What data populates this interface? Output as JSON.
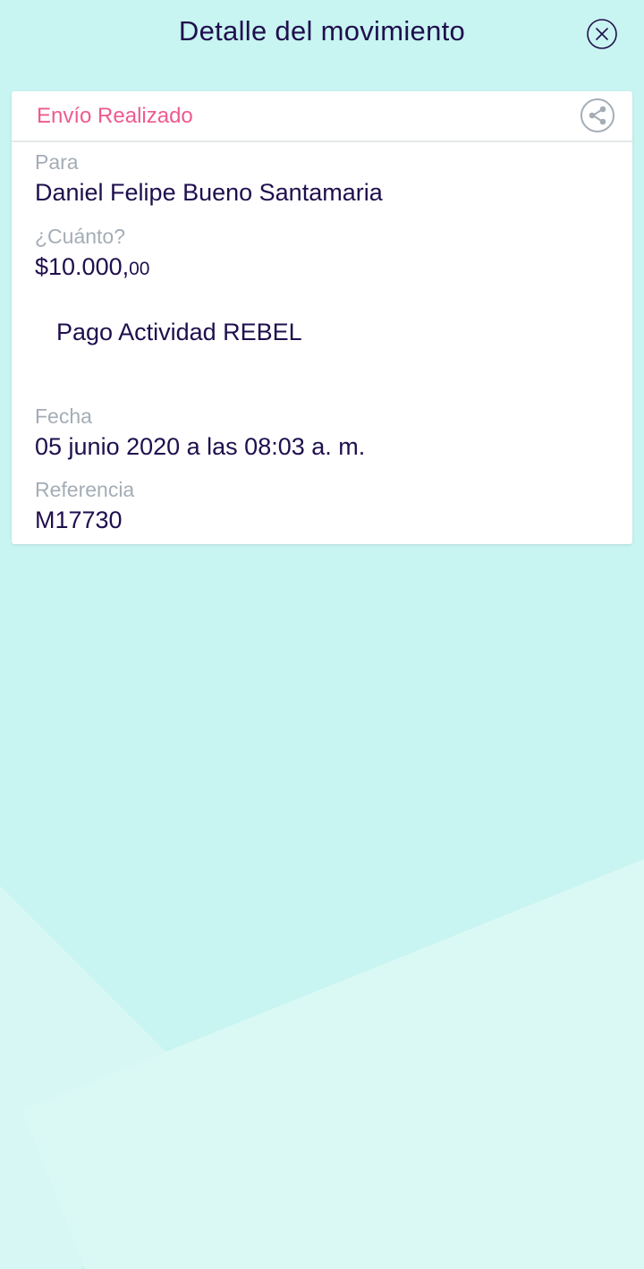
{
  "header": {
    "title": "Detalle del movimiento",
    "close_icon": "close-circle-icon"
  },
  "card": {
    "status": "Envío Realizado",
    "share_icon": "share-icon",
    "recipient_label": "Para",
    "recipient_name": "Daniel Felipe Bueno Santamaria",
    "amount_label": "¿Cuánto?",
    "amount_main": "$10.000,",
    "amount_cents": "00",
    "concept": "Pago Actividad REBEL",
    "date_label": "Fecha",
    "date_value": "05 junio 2020 a las 08:03 a. m.",
    "reference_label": "Referencia",
    "reference_value": "M17730"
  },
  "colors": {
    "background": "#c8f4f1",
    "text_primary": "#1f0f4d",
    "text_label": "#a4adb6",
    "status_accent": "#ef5a8f",
    "card": "#ffffff"
  }
}
